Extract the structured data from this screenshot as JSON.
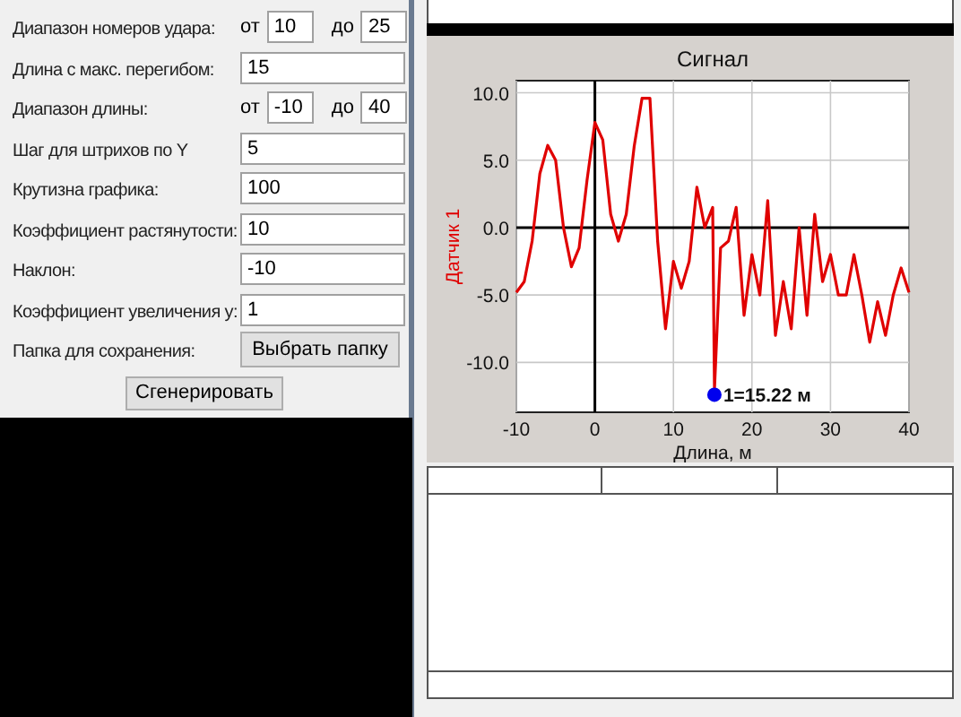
{
  "settings": {
    "rows": [
      {
        "kind": "range",
        "label": "Диапазон номеров удара:",
        "from_label": "от",
        "from": "10",
        "to_label": "до",
        "to": "25"
      },
      {
        "kind": "field",
        "label": "Длина с макс. перегибом:",
        "value": "15"
      },
      {
        "kind": "range",
        "label": "Диапазон длины:",
        "from_label": "от",
        "from": "-10",
        "to_label": "до",
        "to": "40"
      },
      {
        "kind": "field",
        "label": "Шаг для штрихов по Y",
        "value": "5"
      },
      {
        "kind": "field",
        "label": "Крутизна графика:",
        "value": "100"
      },
      {
        "kind": "field",
        "label": "Коэффициент растянутости:",
        "value": "10"
      },
      {
        "kind": "field",
        "label": "Наклон:",
        "value": "-10"
      },
      {
        "kind": "field",
        "label": "Коэффициент увеличения y:",
        "value": "1"
      },
      {
        "kind": "button",
        "label": "Папка для сохранения:",
        "value": "Выбрать папку"
      }
    ],
    "generate_button": "Сгенерировать"
  },
  "plot": {
    "chart_data": {
      "type": "line",
      "title": "Сигнал",
      "xlabel": "Длина, м",
      "ylabel": "Датчик 1",
      "x": [
        -10,
        -9,
        -8,
        -7,
        -6,
        -5,
        -4,
        -3,
        -2,
        -1,
        0,
        1,
        2,
        3,
        4,
        5,
        6,
        7,
        8,
        9,
        10,
        11,
        12,
        13,
        14,
        15,
        15.22,
        16,
        17,
        18,
        19,
        20,
        21,
        22,
        23,
        24,
        25,
        26,
        27,
        28,
        29,
        30,
        31,
        32,
        33,
        34,
        35,
        36,
        37,
        38,
        39,
        40
      ],
      "grid": true,
      "series": [
        {
          "color": "#e00000",
          "values": [
            -4.8,
            -4,
            -1,
            4,
            6.1,
            5,
            0,
            -2.9,
            -1.5,
            3.5,
            7.8,
            6.5,
            1,
            -1,
            1,
            6,
            9.6,
            9.6,
            -1,
            -7.5,
            -2.5,
            -4.5,
            -2.5,
            3,
            0,
            1.5,
            -12,
            -1.5,
            -1,
            1.5,
            -6.5,
            -2,
            -5,
            2,
            -8,
            -4,
            -7.5,
            0,
            -6.5,
            1,
            -4,
            -2,
            -5,
            -5,
            -2,
            -5,
            -8.5,
            -5.5,
            -8,
            -5,
            -3,
            -4.8
          ]
        }
      ],
      "xlim": [
        -10,
        40
      ],
      "ylim": [
        -13.7,
        10.9
      ],
      "xticks": [
        -10,
        0,
        10,
        20,
        30,
        40
      ],
      "yticks": [
        {
          "value": 10,
          "label": "10.0"
        },
        {
          "value": 5,
          "label": "5.0"
        },
        {
          "value": 0,
          "label": "0.0"
        },
        {
          "value": -5,
          "label": "-5.0"
        },
        {
          "value": -10,
          "label": "-10.0"
        }
      ],
      "annotations": [
        {
          "text": "1=15.22 м",
          "x": 15.22,
          "y": -12.4
        }
      ]
    }
  }
}
